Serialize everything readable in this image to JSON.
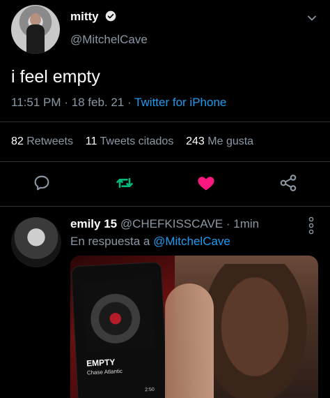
{
  "tweet": {
    "display_name": "mitty",
    "handle": "@MitchelCave",
    "text": "i feel empty",
    "time": "11:51 PM",
    "date": "18 feb. 21",
    "source": "Twitter for iPhone"
  },
  "stats": {
    "retweets_count": "82",
    "retweets_label": "Retweets",
    "quotes_count": "11",
    "quotes_label": "Tweets citados",
    "likes_count": "243",
    "likes_label": "Me gusta"
  },
  "actions": {
    "reply_icon": "reply-icon",
    "retweet_icon": "retweet-icon",
    "like_icon": "heart-icon",
    "share_icon": "share-icon",
    "retweet_color": "#00ba7c",
    "like_color": "#f91880"
  },
  "reply": {
    "display_name": "emily 15",
    "handle": "@CHEFKISSCAVE",
    "time": "1min",
    "replying_to_label": "En respuesta a",
    "replying_to_mention": "@MitchelCave",
    "media": {
      "song_title": "EMPTY",
      "artist": "Chase Atlantic",
      "time": "2:50"
    }
  },
  "colors": {
    "background": "#000000",
    "secondary_text": "#8b98a5",
    "link": "#1d9bf0",
    "divider": "#2f3336"
  }
}
